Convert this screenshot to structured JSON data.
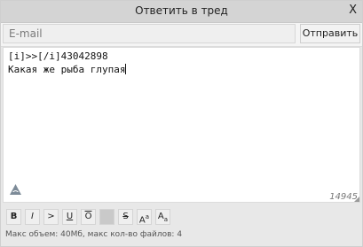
{
  "window": {
    "title": "Ответить в тред",
    "close_label": "X"
  },
  "email": {
    "placeholder": "E-mail",
    "value": "",
    "send_label": "Отправить"
  },
  "message": {
    "line1": "[i]>>[/i]43042898",
    "line2": "Какая же рыба глупая",
    "counter": "14945"
  },
  "toolbar": {
    "buttons": [
      "B",
      "I",
      ">",
      "U",
      "O",
      "",
      "S",
      "A",
      "A"
    ],
    "sup_a": "a",
    "sub_a": "a"
  },
  "footer": {
    "limits": "Макс объем: 40Мб, макс кол-во файлов: 4"
  },
  "icons": {
    "logo": "stylized-triangle-logo-icon",
    "resize": "resize-corner-icon"
  }
}
